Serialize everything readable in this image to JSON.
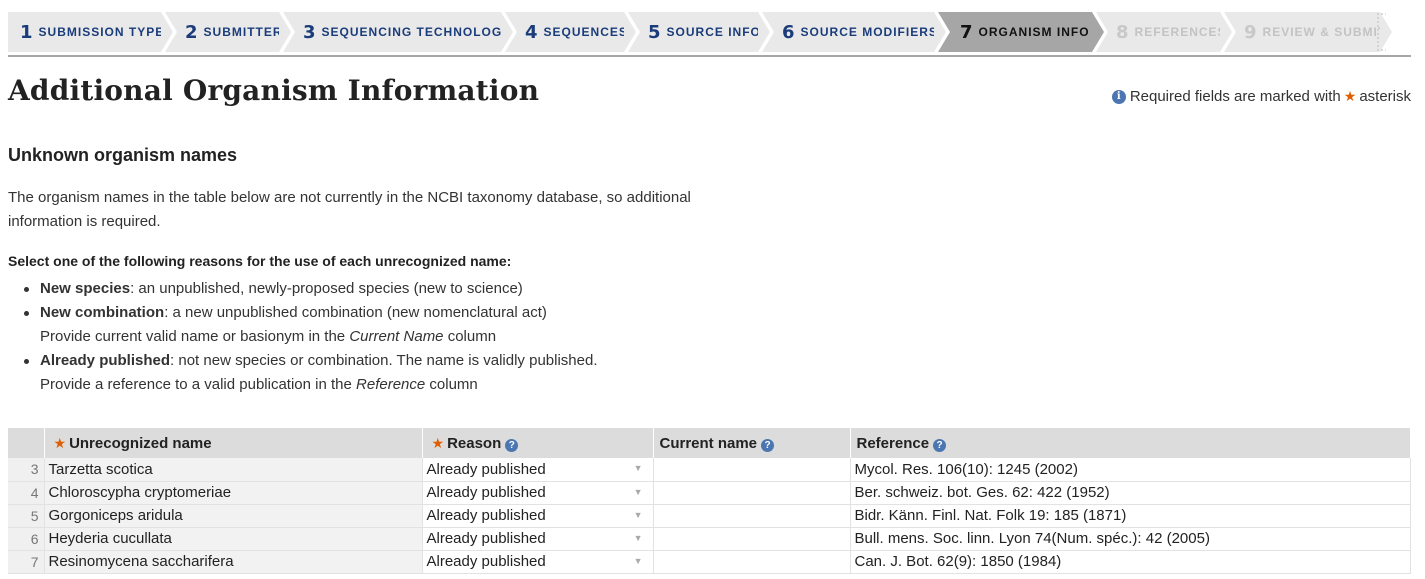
{
  "steps": [
    {
      "num": "1",
      "label": "SUBMISSION TYPE",
      "state": "done"
    },
    {
      "num": "2",
      "label": "SUBMITTER",
      "state": "done"
    },
    {
      "num": "3",
      "label": "SEQUENCING TECHNOLOGY",
      "state": "done"
    },
    {
      "num": "4",
      "label": "SEQUENCES",
      "state": "done"
    },
    {
      "num": "5",
      "label": "SOURCE INFO",
      "state": "done"
    },
    {
      "num": "6",
      "label": "SOURCE MODIFIERS",
      "state": "done"
    },
    {
      "num": "7",
      "label": "ORGANISM INFO",
      "state": "active"
    },
    {
      "num": "8",
      "label": "REFERENCES",
      "state": "disabled"
    },
    {
      "num": "9",
      "label": "REVIEW & SUBMIT",
      "state": "disabled"
    }
  ],
  "page_title": "Additional Organism Information",
  "required_note": {
    "prefix": "Required fields are marked with",
    "suffix": "asterisk"
  },
  "section_title": "Unknown organism names",
  "intro_text": "The organism names in the table below are not currently in the NCBI taxonomy database, so additional information is required.",
  "prompt": "Select one of the following reasons for the use of each unrecognized name:",
  "reasons": [
    {
      "term": "New species",
      "desc": ": an unpublished, newly-proposed species (new to science)"
    },
    {
      "term": "New combination",
      "desc": ": a new unpublished combination (new nomenclatural act)",
      "note_pre": "Provide current valid name or basionym in the ",
      "note_em": "Current Name",
      "note_post": " column"
    },
    {
      "term": "Already published",
      "desc": ": not new species or combination. The name is validly published.",
      "note_pre": "Provide a reference to a valid publication in the ",
      "note_em": "Reference",
      "note_post": " column"
    }
  ],
  "table": {
    "headers": {
      "name": "Unrecognized name",
      "reason": "Reason",
      "current": "Current name",
      "reference": "Reference"
    },
    "rows": [
      {
        "num": "3",
        "name": "Tarzetta scotica",
        "reason": "Already published",
        "current": "",
        "reference": "Mycol. Res. 106(10): 1245 (2002)"
      },
      {
        "num": "4",
        "name": "Chloroscypha cryptomeriae",
        "reason": "Already published",
        "current": "",
        "reference": "Ber. schweiz. bot. Ges. 62: 422 (1952)"
      },
      {
        "num": "5",
        "name": "Gorgoniceps aridula",
        "reason": "Already published",
        "current": "",
        "reference": "Bidr. Känn. Finl. Nat. Folk 19: 185 (1871)"
      },
      {
        "num": "6",
        "name": "Heyderia cucullata",
        "reason": "Already published",
        "current": "",
        "reference": "Bull. mens. Soc. linn. Lyon 74(Num. spéc.): 42 (2005)"
      },
      {
        "num": "7",
        "name": "Resinomycena saccharifera",
        "reason": "Already published",
        "current": "",
        "reference": "Can. J. Bot. 62(9): 1850 (1984)"
      }
    ]
  },
  "colors": {
    "accent_star": "#e05e00",
    "step_text": "#1a3c7a",
    "info_icon": "#4b76b1"
  }
}
